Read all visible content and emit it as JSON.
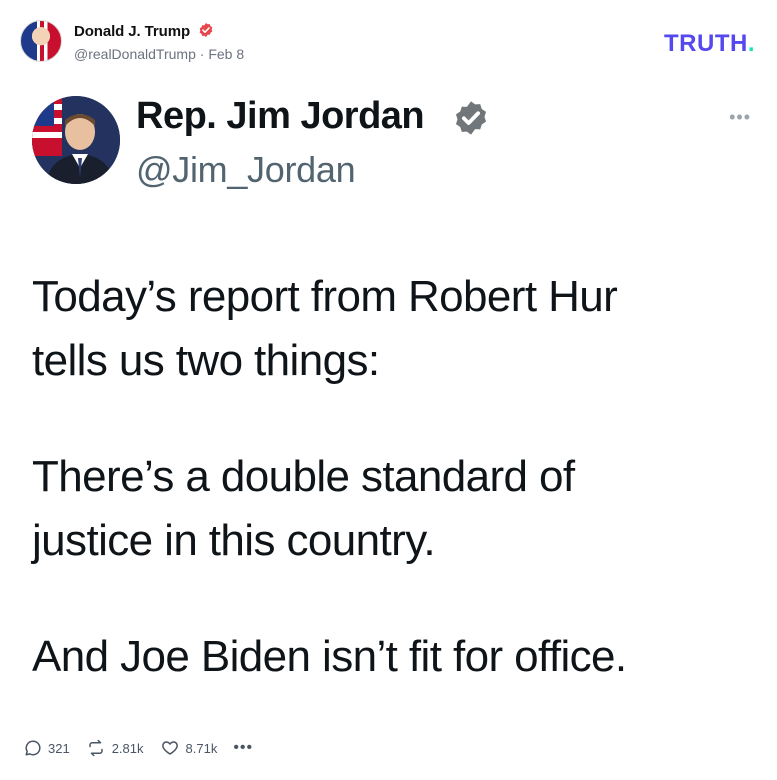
{
  "post": {
    "author_name": "Donald J. Trump",
    "author_handle": "@realDonaldTrump",
    "date": "Feb 8",
    "meta_separator": "·",
    "brand": {
      "text": "TRUTH",
      "dot": ".",
      "color": "#5448ee",
      "dot_color": "#17e2b5"
    },
    "verified_color": "#e5484d"
  },
  "embedded_tweet": {
    "name": "Rep. Jim Jordan",
    "handle": "@Jim_Jordan",
    "more_label": "•••",
    "verified_color": "#71767b",
    "paragraphs": [
      [
        "Today’s report from Robert Hur",
        "tells us two things:"
      ],
      [
        "There’s a double standard of",
        "justice in this country."
      ],
      [
        "And Joe Biden isn’t fit for office."
      ]
    ]
  },
  "actions": {
    "replies": "321",
    "retruths": "2.81k",
    "likes": "8.71k",
    "more_label": "•••"
  }
}
